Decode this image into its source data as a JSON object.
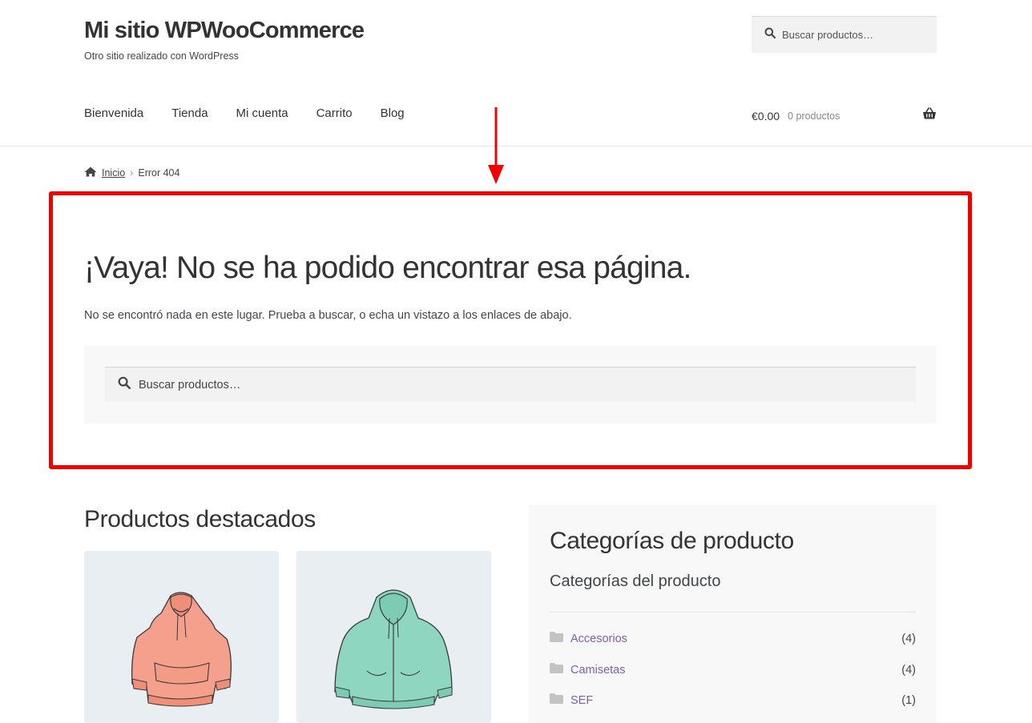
{
  "header": {
    "site_title": "Mi sitio WPWooCommerce",
    "site_description": "Otro sitio realizado con WordPress",
    "search_placeholder": "Buscar productos…"
  },
  "nav": {
    "items": [
      {
        "label": "Bienvenida"
      },
      {
        "label": "Tienda"
      },
      {
        "label": "Mi cuenta"
      },
      {
        "label": "Carrito"
      },
      {
        "label": "Blog"
      }
    ]
  },
  "cart": {
    "amount": "€0.00",
    "count": "0 productos"
  },
  "breadcrumb": {
    "home": "Inicio",
    "current": "Error 404"
  },
  "error": {
    "title": "¡Vaya! No se ha podido encontrar esa página.",
    "message": "No se encontró nada en este lugar. Prueba a buscar, o echa un vistazo a los enlaces de abajo.",
    "search_placeholder": "Buscar productos…"
  },
  "featured": {
    "title": "Productos destacados",
    "products": [
      {
        "image": "hoodie-icon",
        "color": "#f5a08c"
      },
      {
        "image": "zip-hoodie-icon",
        "color": "#8fd6c0"
      }
    ]
  },
  "categories_widget": {
    "title": "Categorías de producto",
    "subtitle": "Categorías del producto",
    "items": [
      {
        "name": "Accesorios",
        "count": "(4)"
      },
      {
        "name": "Camisetas",
        "count": "(4)"
      },
      {
        "name": "SEF",
        "count": "(1)"
      }
    ]
  },
  "annotation": {
    "highlight_color": "#f20000"
  },
  "colors": {
    "link": "#7c5fb0",
    "text": "#43454b",
    "heading": "#333333"
  }
}
